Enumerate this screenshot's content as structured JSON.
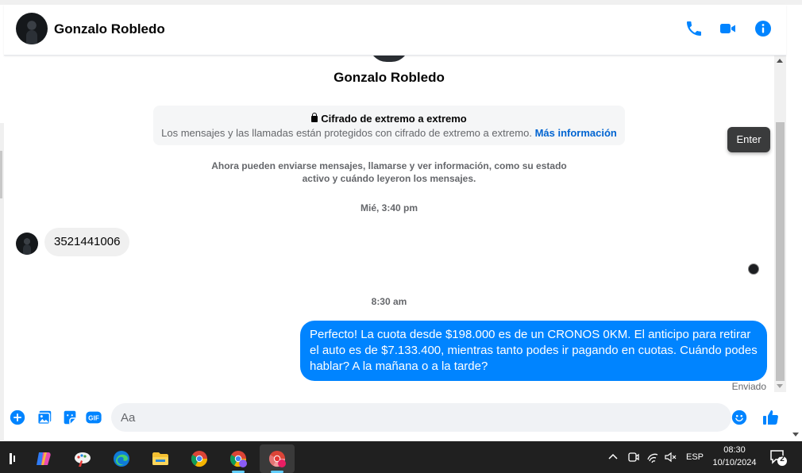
{
  "header": {
    "contact_name": "Gonzalo Robledo",
    "icons": [
      "phone-icon",
      "video-camera-icon",
      "info-icon"
    ]
  },
  "profile": {
    "name": "Gonzalo Robledo"
  },
  "encryption": {
    "title": "Cifrado de extremo a extremo",
    "description": "Los mensajes y las llamadas están protegidos con cifrado de extremo a extremo.",
    "link": "Más información"
  },
  "info_notice": "Ahora pueden enviarse mensajes, llamarse y ver información, como su estado activo y cuándo leyeron los mensajes.",
  "messages": [
    {
      "timestamp": "Mié, 3:40 pm",
      "direction": "incoming",
      "text": "3521441006"
    },
    {
      "timestamp": "8:30 am",
      "direction": "outgoing",
      "text": "Perfecto! La cuota desde $198.000 es de un CRONOS 0KM. El anticipo para retirar el auto es de $7.133.400, mientras tanto podes ir pagando en cuotas. Cuándo podes hablar? A la mañana o a la tarde?",
      "status": "Enviado"
    }
  ],
  "tooltip": "Enter",
  "composer": {
    "placeholder": "Aa",
    "icons": [
      "add-circle-icon",
      "photo-icon",
      "sticker-icon",
      "gif-icon",
      "emoji-icon",
      "like-thumb-icon"
    ],
    "gif_label": "GIF"
  },
  "colors": {
    "accent": "#0084ff",
    "link": "#0064d1"
  },
  "taskbar": {
    "apps": [
      "task-view-icon",
      "copilot-icon",
      "paint-icon",
      "edge-icon",
      "file-explorer-icon",
      "chrome-icon",
      "chrome-profile-icon",
      "chrome-profile-active-icon"
    ],
    "language": "ESP",
    "time": "08:30",
    "date": "10/10/2024",
    "notification_count": "2"
  }
}
